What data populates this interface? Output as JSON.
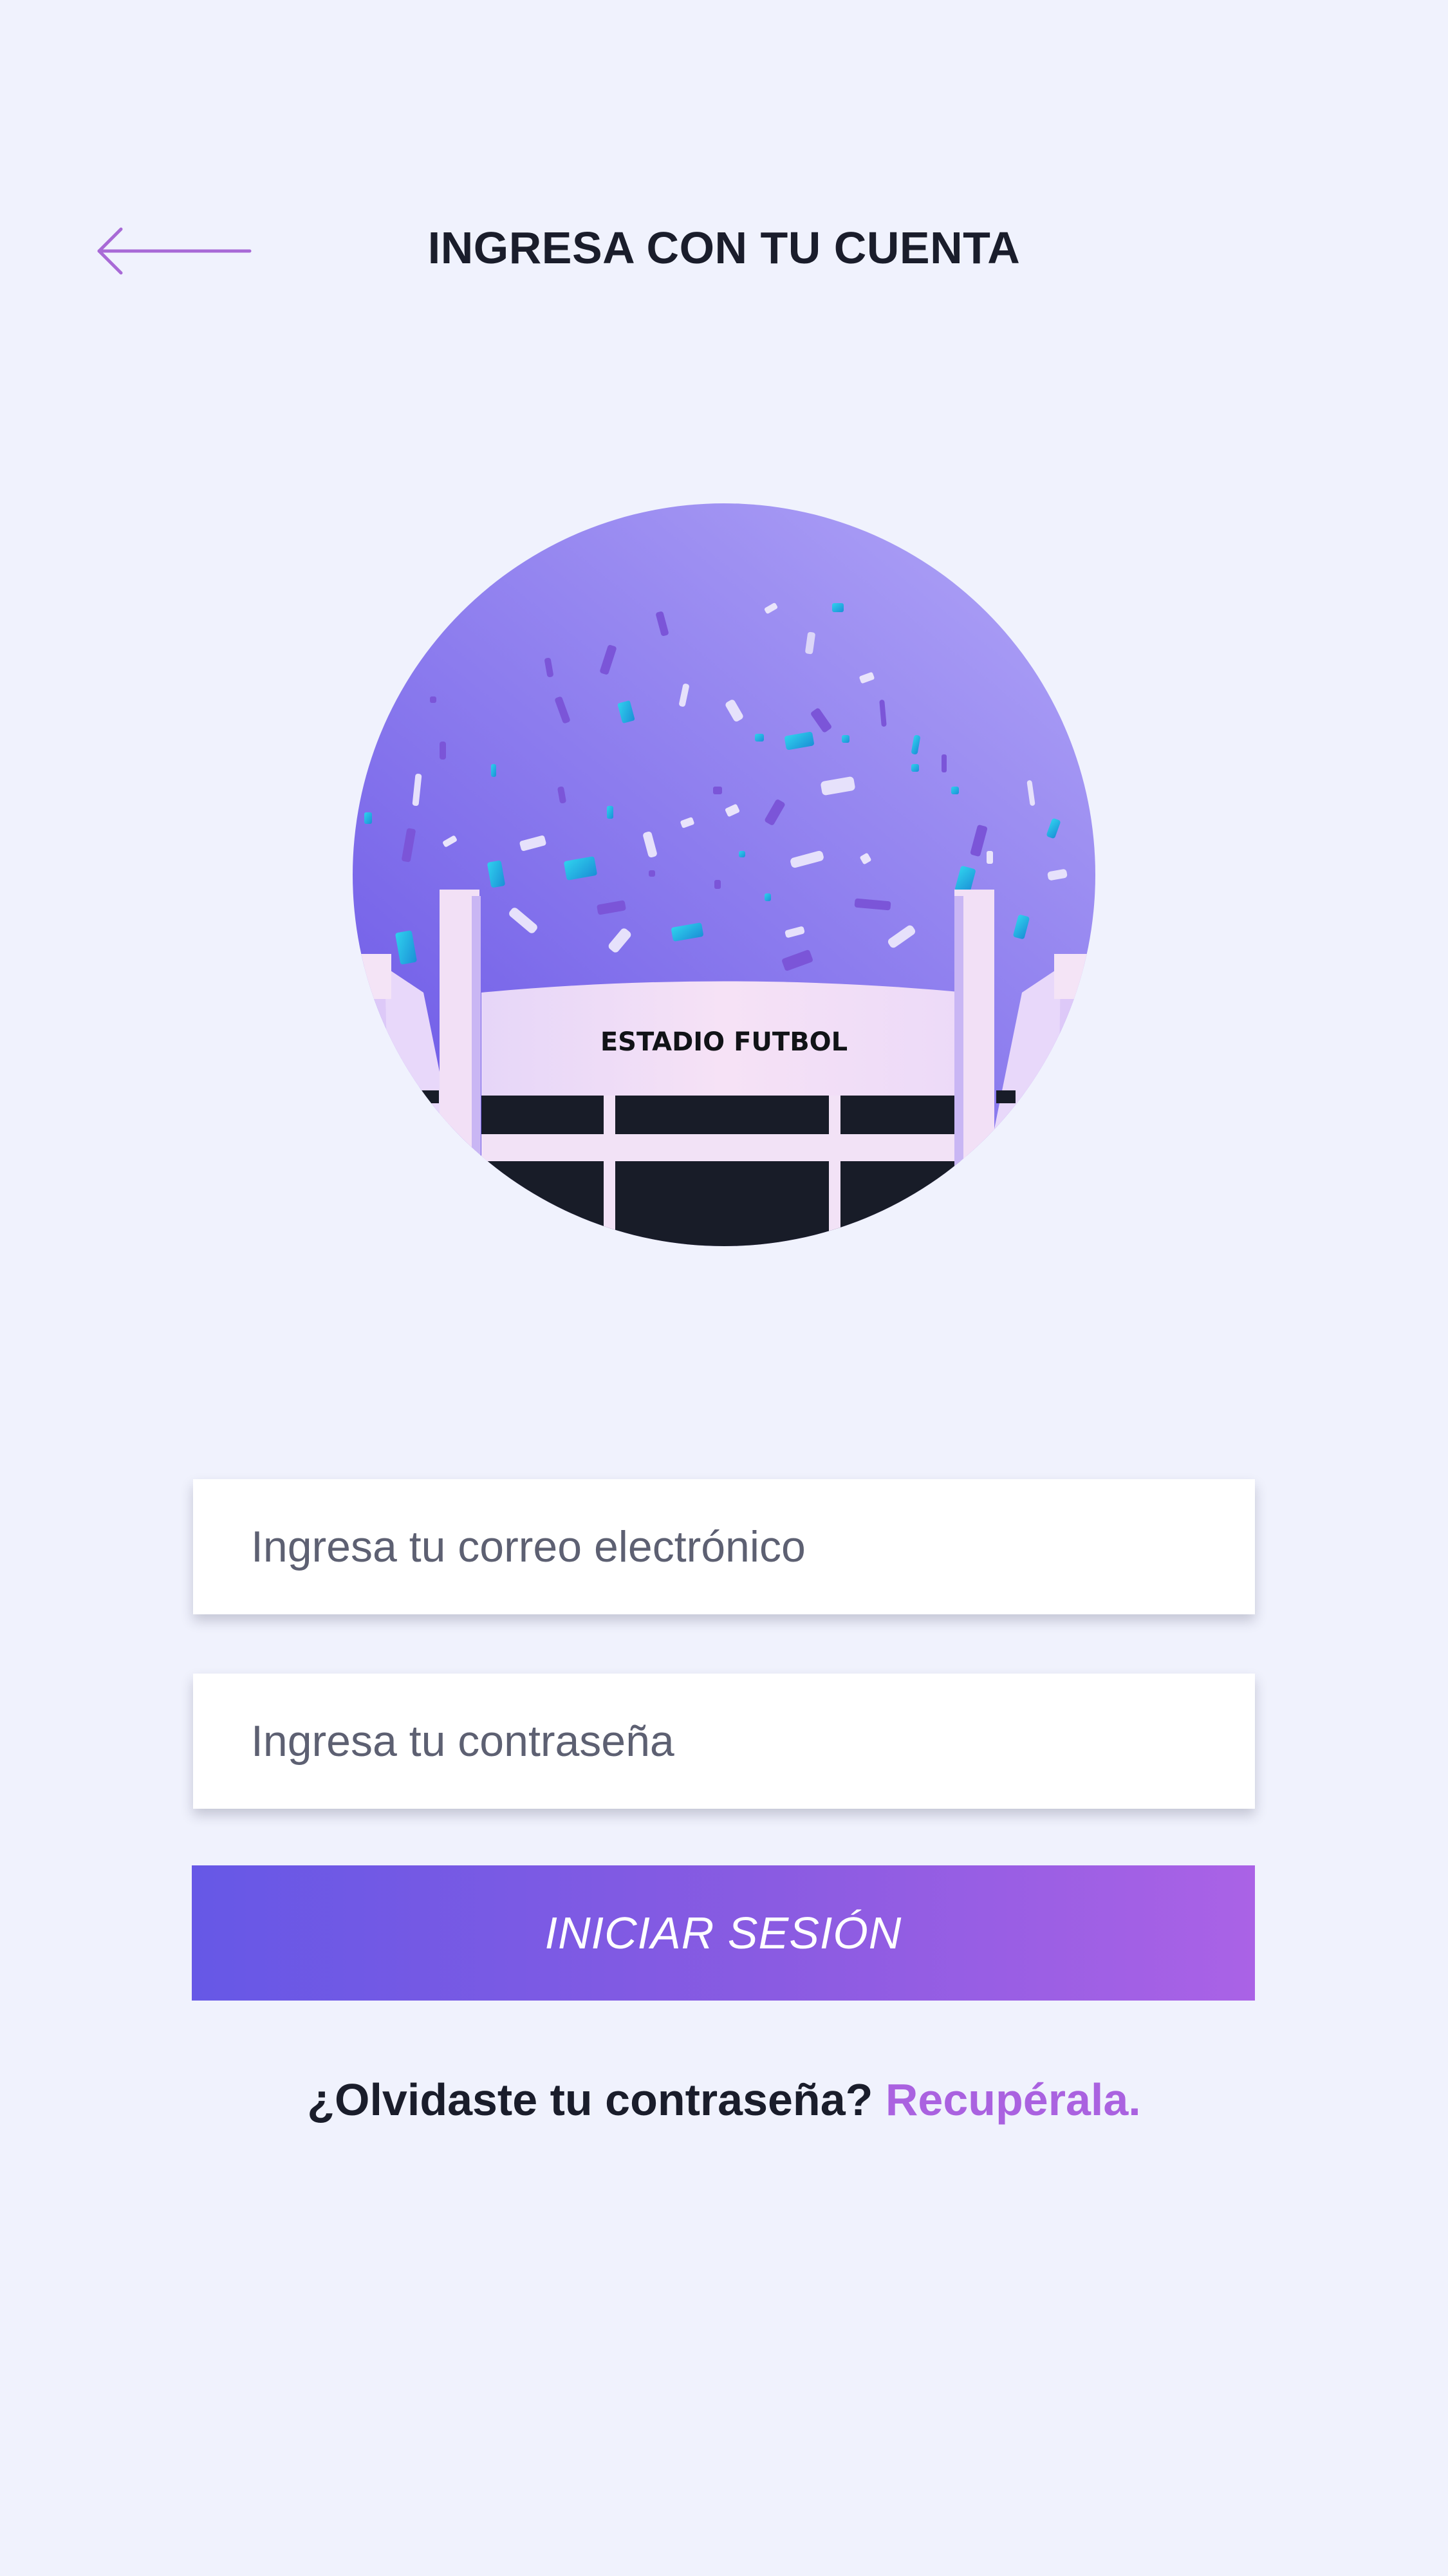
{
  "header": {
    "title": "INGRESA CON TU CUENTA",
    "back_icon": "arrow-left-icon"
  },
  "hero": {
    "stadium_sign": "ESTADIO FUTBOL"
  },
  "form": {
    "email_placeholder": "Ingresa tu correo electrónico",
    "password_placeholder": "Ingresa tu contraseña",
    "submit_label": "INICIAR SESIÓN"
  },
  "footer": {
    "forgot_text": "¿Olvidaste tu contraseña?",
    "recover_link": "Recupérala."
  },
  "colors": {
    "background": "#f0f2fd",
    "accent": "#aa62e0",
    "button_start": "#6658e6",
    "button_end": "#aa62e6",
    "text": "#1a1d2b"
  }
}
